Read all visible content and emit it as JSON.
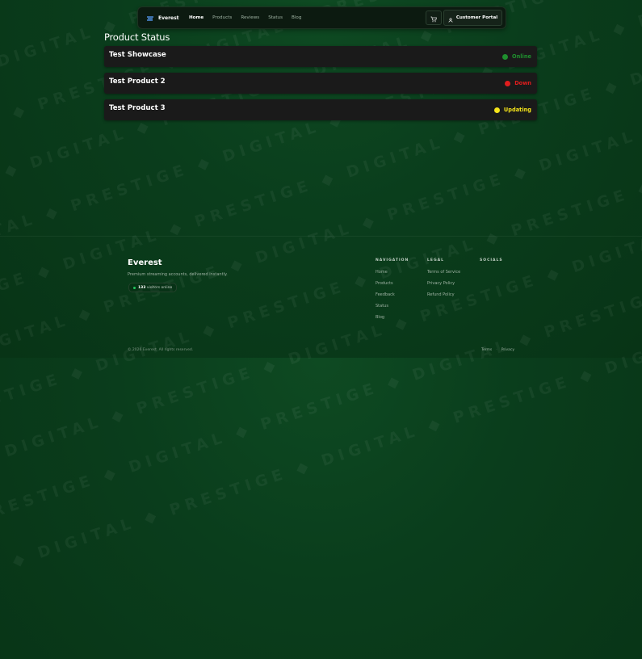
{
  "watermark": "PRESTIGE ◆ DIGITAL ◆ PRESTIGE ◆ DIGITAL ◆ PRESTIGE ◆ DIGITAL ◆ PRESTIGE ◆ DIGITAL ◆",
  "nav": {
    "brand": "Everest",
    "links": [
      "Home",
      "Products",
      "Reviews",
      "Status",
      "Blog"
    ],
    "active": "Home",
    "portal": "Customer Portal"
  },
  "page": {
    "title": "Product Status"
  },
  "statuses": [
    {
      "name": "Test Showcase",
      "state": "Online",
      "color": "#1f8f2e"
    },
    {
      "name": "Test Product 2",
      "state": "Down",
      "color": "#e11d1d"
    },
    {
      "name": "Test Product 3",
      "state": "Updating",
      "color": "#f5e41a"
    }
  ],
  "footer": {
    "brand": "Everest",
    "tagline": "Premium streaming accounts, delivered instantly.",
    "online_count": "133",
    "online_label": "visitors online",
    "navigation": {
      "title": "NAVIGATION",
      "links": [
        "Home",
        "Products",
        "Feedback",
        "Status",
        "Blog"
      ]
    },
    "legal": {
      "title": "LEGAL",
      "links": [
        "Terms of Service",
        "Privacy Policy",
        "Refund Policy"
      ]
    },
    "socials": {
      "title": "SOCIALS"
    },
    "copyright": "© 2026 Everest. All rights reserved.",
    "bottom_links": [
      "Terms",
      "Privacy"
    ]
  }
}
